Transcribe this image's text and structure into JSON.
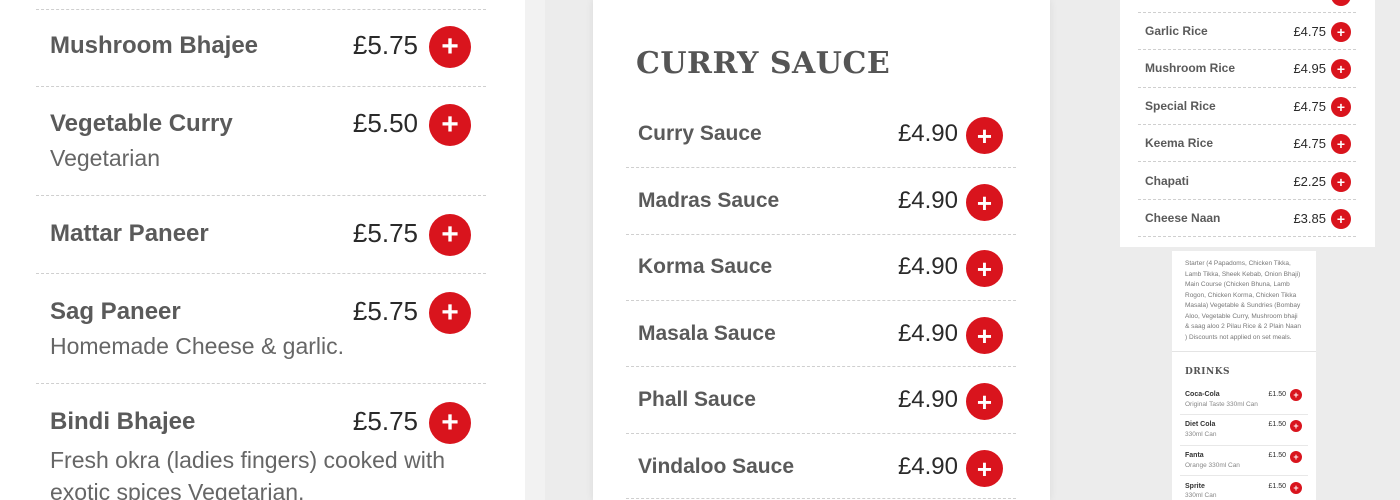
{
  "panel_a": {
    "items": [
      {
        "name": "Mushroom Bhajee",
        "price": "£5.75",
        "desc": ""
      },
      {
        "name": "Vegetable Curry",
        "price": "£5.50",
        "desc": "Vegetarian"
      },
      {
        "name": "Mattar Paneer",
        "price": "£5.75",
        "desc": ""
      },
      {
        "name": "Sag Paneer",
        "price": "£5.75",
        "desc": "Homemade Cheese & garlic."
      },
      {
        "name": "Bindi Bhajee",
        "price": "£5.75",
        "desc": "Fresh okra (ladies fingers) cooked with exotic spices Vegetarian."
      }
    ]
  },
  "panel_b": {
    "heading": "CURRY SAUCE",
    "items": [
      {
        "name": "Curry Sauce",
        "price": "£4.90"
      },
      {
        "name": "Madras Sauce",
        "price": "£4.90"
      },
      {
        "name": "Korma Sauce",
        "price": "£4.90"
      },
      {
        "name": "Masala Sauce",
        "price": "£4.90"
      },
      {
        "name": "Phall Sauce",
        "price": "£4.90"
      },
      {
        "name": "Vindaloo Sauce",
        "price": "£4.90"
      }
    ]
  },
  "panel_c": {
    "items": [
      {
        "name": "Garlic Rice",
        "price": "£4.75"
      },
      {
        "name": "Mushroom Rice",
        "price": "£4.95"
      },
      {
        "name": "Special Rice",
        "price": "£4.75"
      },
      {
        "name": "Keema Rice",
        "price": "£4.75"
      },
      {
        "name": "Chapati",
        "price": "£2.25"
      },
      {
        "name": "Cheese Naan",
        "price": "£3.85"
      }
    ]
  },
  "panel_d": {
    "set_meal_desc": "Starter (4 Papadoms, Chicken Tikka, Lamb Tikka, Sheek Kebab, Onion Bhaji) Main Course (Chicken Bhuna, Lamb Rogon, Chicken Korma, Chicken Tikka Masala) Vegetable & Sundries (Bombay Aloo, Vegetable Curry, Mushroom bhaji & saag aloo 2 Pilau Rice & 2 Plain Naan ) Discounts not applied on set meals.",
    "drinks_heading": "DRINKS",
    "drinks": [
      {
        "name": "Coca-Cola",
        "price": "£1.50",
        "desc": "Original Taste 330ml Can"
      },
      {
        "name": "Diet Cola",
        "price": "£1.50",
        "desc": "330ml Can"
      },
      {
        "name": "Fanta",
        "price": "£1.50",
        "desc": "Orange 330ml Can"
      },
      {
        "name": "Sprite",
        "price": "£1.50",
        "desc": "330ml Can"
      }
    ]
  },
  "add_symbol": "+",
  "colors": {
    "accent": "#d9141d",
    "card": "#ffffff",
    "background": "#ececec"
  }
}
